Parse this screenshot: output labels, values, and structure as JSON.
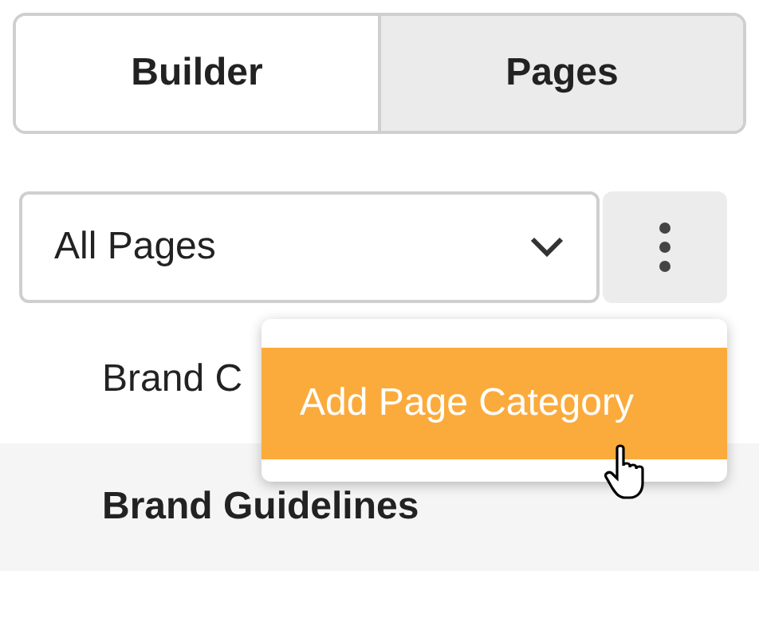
{
  "tabs": [
    {
      "label": "Builder",
      "selected": false
    },
    {
      "label": "Pages",
      "selected": true
    }
  ],
  "filter": {
    "value": "All Pages"
  },
  "menu": {
    "items": [
      {
        "label": "Add Page Category",
        "selected": true
      }
    ]
  },
  "pages": [
    {
      "label": "Brand C",
      "selected": false
    },
    {
      "label": "Brand Guidelines",
      "selected": true
    }
  ]
}
